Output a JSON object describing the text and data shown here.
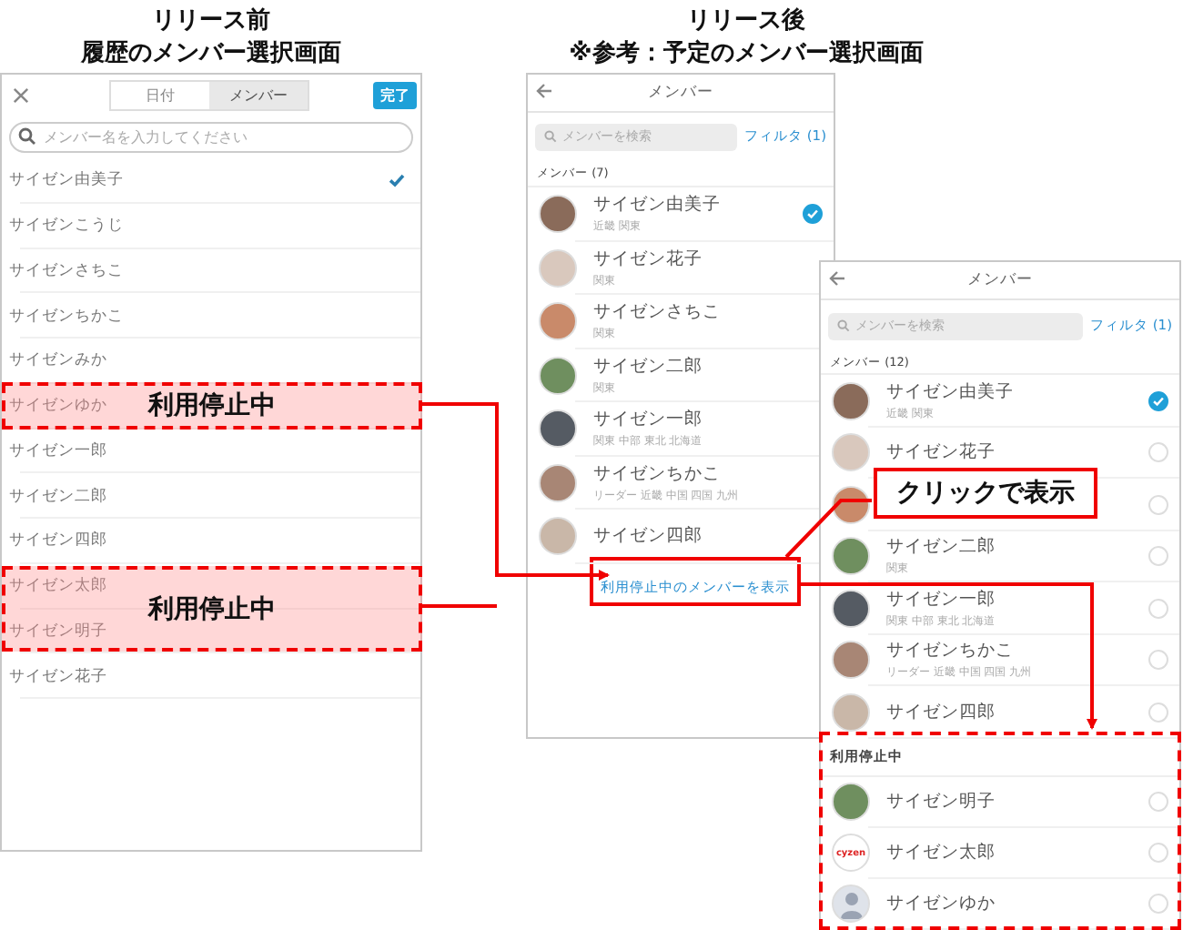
{
  "before": {
    "heading": "リリース前",
    "subheading": "履歴のメンバー選択画面",
    "tabs": [
      {
        "label": "日付",
        "selected": false
      },
      {
        "label": "メンバー",
        "selected": true
      }
    ],
    "done_button": "完了",
    "search": {
      "placeholder": "メンバー名を入力してください"
    },
    "members": [
      {
        "name": "サイゼン由美子",
        "checked": true
      },
      {
        "name": "サイゼンこうじ",
        "checked": false
      },
      {
        "name": "サイゼンさちこ",
        "checked": false
      },
      {
        "name": "サイゼンちかこ",
        "checked": false
      },
      {
        "name": "サイゼンみか",
        "checked": false
      },
      {
        "name": "サイゼンゆか",
        "checked": false
      },
      {
        "name": "サイゼン一郎",
        "checked": false
      },
      {
        "name": "サイゼン二郎",
        "checked": false
      },
      {
        "name": "サイゼン四郎",
        "checked": false
      },
      {
        "name": "サイゼン太郎",
        "checked": false
      },
      {
        "name": "サイゼン明子",
        "checked": false
      },
      {
        "name": "サイゼン花子",
        "checked": false
      }
    ],
    "highlights": [
      {
        "label": "利用停止中"
      },
      {
        "label": "利用停止中"
      }
    ]
  },
  "after": {
    "heading": "リリース後",
    "subheading": "※参考：予定のメンバー選択画面",
    "header_title": "メンバー",
    "search": {
      "placeholder": "メンバーを検索"
    },
    "filter": "フィルタ (1)",
    "section": "メンバー (7)",
    "members": [
      {
        "name": "サイゼン由美子",
        "sub": "近畿 関東",
        "checked": true
      },
      {
        "name": "サイゼン花子",
        "sub": "関東",
        "checked": false
      },
      {
        "name": "サイゼンさちこ",
        "sub": "関東",
        "checked": false
      },
      {
        "name": "サイゼン二郎",
        "sub": "関東",
        "checked": false
      },
      {
        "name": "サイゼン一郎",
        "sub": "関東 中部 東北 北海道",
        "checked": false
      },
      {
        "name": "サイゼンちかこ",
        "sub": "リーダー 近畿 中国 四国 九州",
        "checked": false
      },
      {
        "name": "サイゼン四郎",
        "checked": false
      }
    ],
    "show_deactivated_link": "利用停止中のメンバーを表示"
  },
  "expanded": {
    "header_title": "メンバー",
    "search": {
      "placeholder": "メンバーを検索"
    },
    "filter": "フィルタ (1)",
    "section": "メンバー (12)",
    "members": [
      {
        "name": "サイゼン由美子",
        "sub": "近畿 関東",
        "checked": true
      },
      {
        "name": "サイゼン花子",
        "checked": false
      },
      {
        "checked": false
      },
      {
        "name": "サイゼン二郎",
        "sub": "関東",
        "checked": false
      },
      {
        "name": "サイゼン一郎",
        "sub": "関東 中部 東北 北海道",
        "checked": false
      },
      {
        "name": "サイゼンちかこ",
        "sub": "リーダー 近畿 中国 四国 九州",
        "checked": false
      },
      {
        "name": "サイゼン四郎",
        "checked": false
      }
    ],
    "deactivated_section": "利用停止中",
    "deactivated_members": [
      {
        "name": "サイゼン明子",
        "kind": "photo",
        "checked": false
      },
      {
        "name": "サイゼン太郎",
        "kind": "logo",
        "logo_text": "cyzen",
        "checked": false
      },
      {
        "name": "サイゼンゆか",
        "kind": "silhouette",
        "checked": false
      }
    ]
  },
  "callout": "クリックで表示"
}
